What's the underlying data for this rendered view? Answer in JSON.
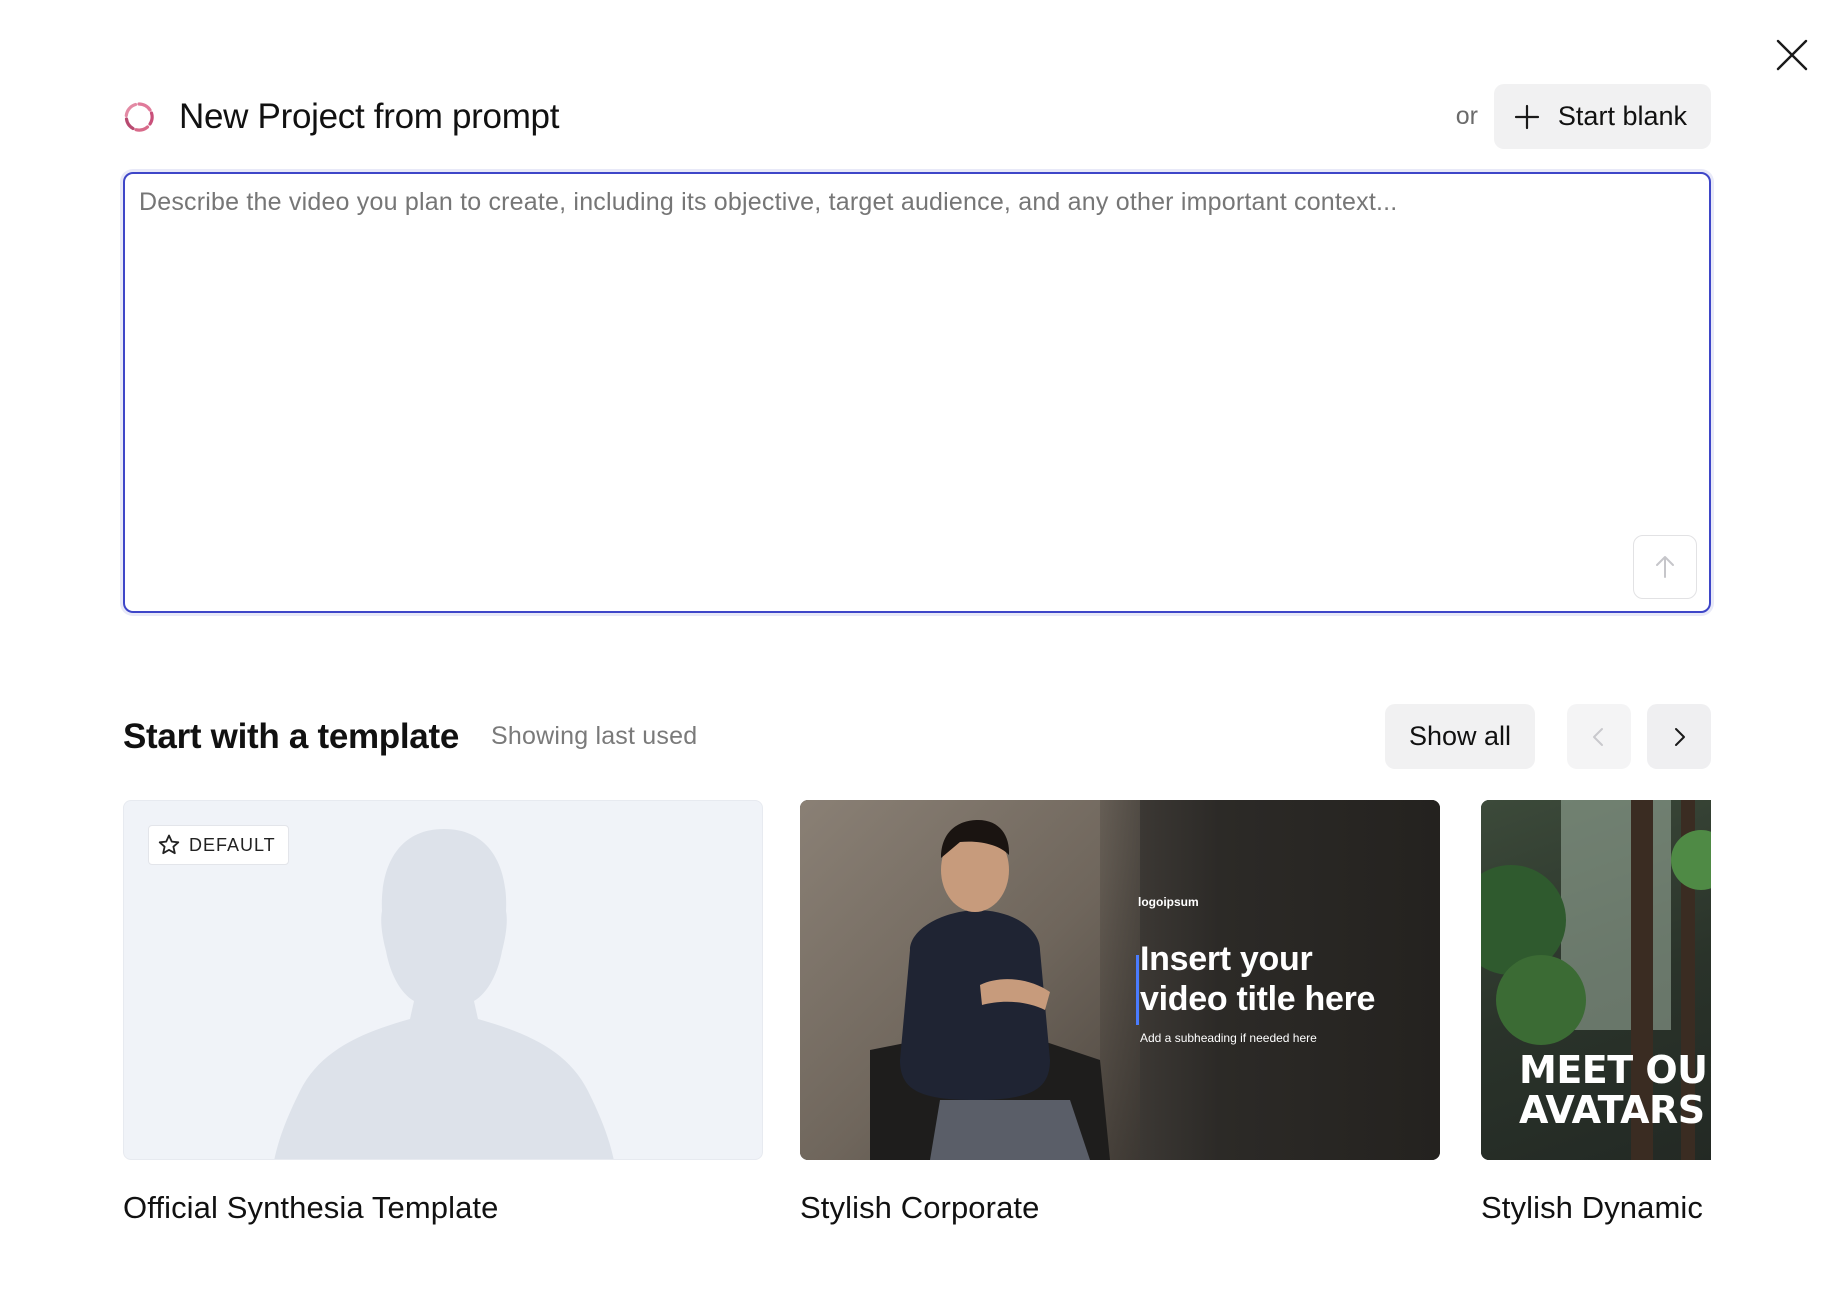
{
  "header": {
    "title": "New Project from prompt",
    "or_text": "or",
    "start_blank_label": "Start blank"
  },
  "prompt": {
    "placeholder": "Describe the video you plan to create, including its objective, target audience, and any other important context...",
    "value": ""
  },
  "templates": {
    "title": "Start with a template",
    "subtitle": "Showing last used",
    "show_all_label": "Show all",
    "items": [
      {
        "label": "Official Synthesia Template",
        "badge": "DEFAULT"
      },
      {
        "label": "Stylish Corporate",
        "thumb_logo": "logoipsum",
        "thumb_title_line1": "Insert your",
        "thumb_title_line2": "video title here",
        "thumb_subtitle": "Add a subheading if needed here"
      },
      {
        "label": "Stylish Dynamic",
        "thumb_line1": "MEET OUR",
        "thumb_line2": "AVATARS"
      }
    ]
  },
  "colors": {
    "accent": "#3e46c8",
    "button_bg": "#f1f1f2",
    "placeholder_bg": "#f0f3f8",
    "silhouette": "#dde2ea"
  },
  "icons": {
    "close": "close-icon",
    "logo": "synthesia-ring-icon",
    "plus": "plus-icon",
    "submit": "arrow-up-icon",
    "prev": "chevron-left-icon",
    "next": "chevron-right-icon",
    "badge": "star-icon"
  }
}
